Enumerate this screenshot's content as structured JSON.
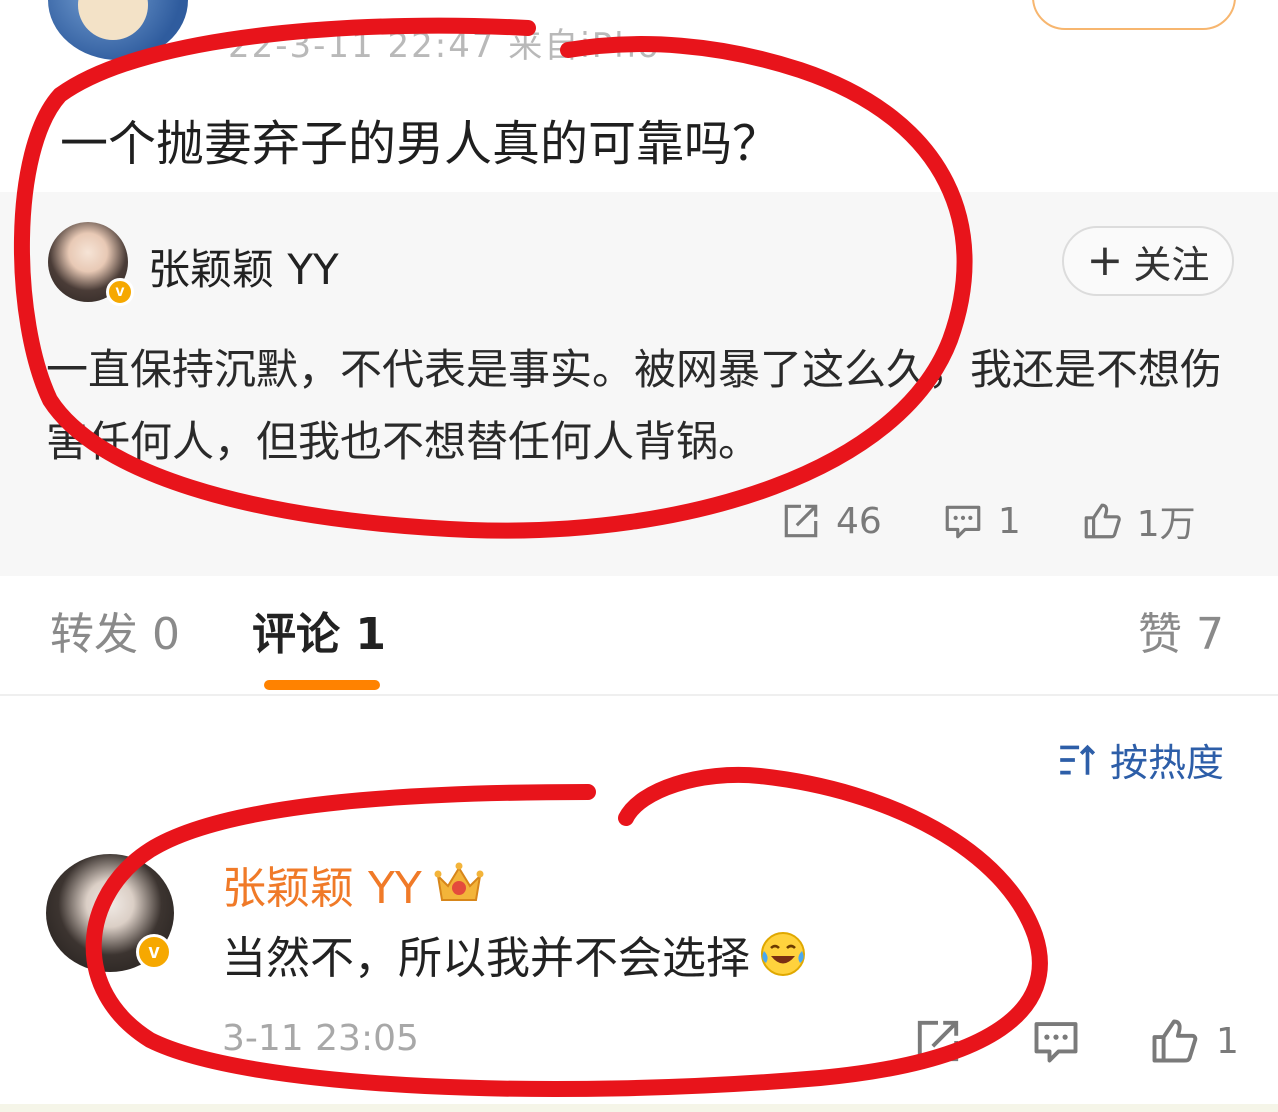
{
  "top_post": {
    "meta": "22-3-11 22:47  来自iPho",
    "question": "一个抛妻弃子的男人真的可靠吗？"
  },
  "repost": {
    "author": "张颖颖 YY",
    "follow_label": "关注",
    "text": "一直保持沉默，不代表是事实。被网暴了这么久，我还是不想伤害任何人，但我也不想替任何人背锅。",
    "reposts": "46",
    "comments": "1",
    "likes": "1万"
  },
  "tabs": {
    "repost": "转发 0",
    "comment": "评论 1",
    "like": "赞 7"
  },
  "sort": {
    "label": "按热度"
  },
  "comment": {
    "author": "张颖颖 YY",
    "text": "当然不，所以我并不会选择",
    "time": "3-11 23:05",
    "likes": "1"
  },
  "colors": {
    "accent_orange": "#ff8200",
    "name_orange": "#f07a28",
    "link_blue": "#2d5ea8",
    "annotation_red": "#e8141b",
    "verified_badge": "#f6a800"
  },
  "icons": [
    "share-icon",
    "comment-icon",
    "like-icon",
    "sort-icon",
    "crown-icon",
    "laugh-cry-emoji"
  ]
}
